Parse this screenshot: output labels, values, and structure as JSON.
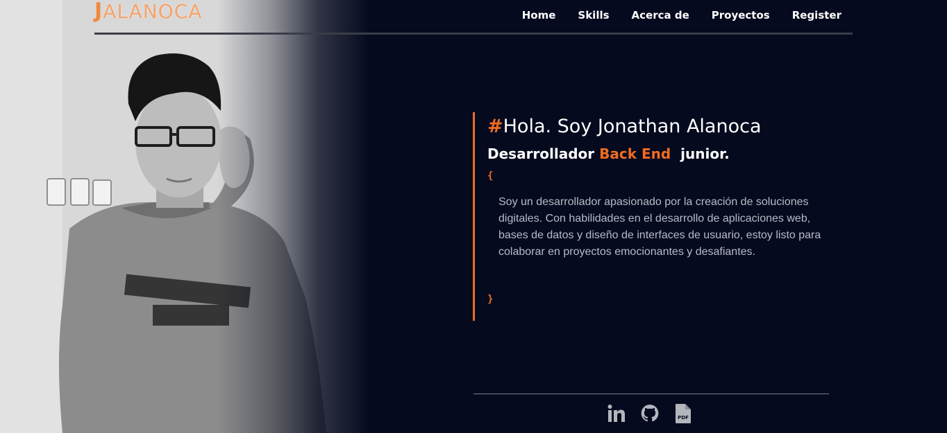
{
  "logo": {
    "mark": "J",
    "text": "ALANOCA"
  },
  "nav": {
    "items": [
      {
        "label": "Home"
      },
      {
        "label": "Skills"
      },
      {
        "label": "Acerca de"
      },
      {
        "label": "Proyectos"
      },
      {
        "label": "Register"
      }
    ]
  },
  "intro": {
    "hash": "#",
    "greeting": "Hola. Soy Jonathan Alanoca",
    "role_prefix": "Desarrollador",
    "role_accent": "Back End",
    "role_suffix": "junior.",
    "brace_open": "{",
    "description": "Soy un desarrollador apasionado por la creación de soluciones digitales. Con habilidades en el desarrollo de aplicaciones web, bases de datos y diseño de interfaces de usuario, estoy listo para colaborar en proyectos emocionantes y desafiantes.",
    "brace_close": "}"
  },
  "social": {
    "icons": [
      "linkedin-icon",
      "github-icon",
      "pdf-icon"
    ],
    "pdf_label": "PDF"
  },
  "colors": {
    "background": "#050a1e",
    "accent": "#f26b21",
    "text": "#ffffff",
    "muted_text": "#b8bbc6",
    "icon": "#b4b6bd"
  }
}
